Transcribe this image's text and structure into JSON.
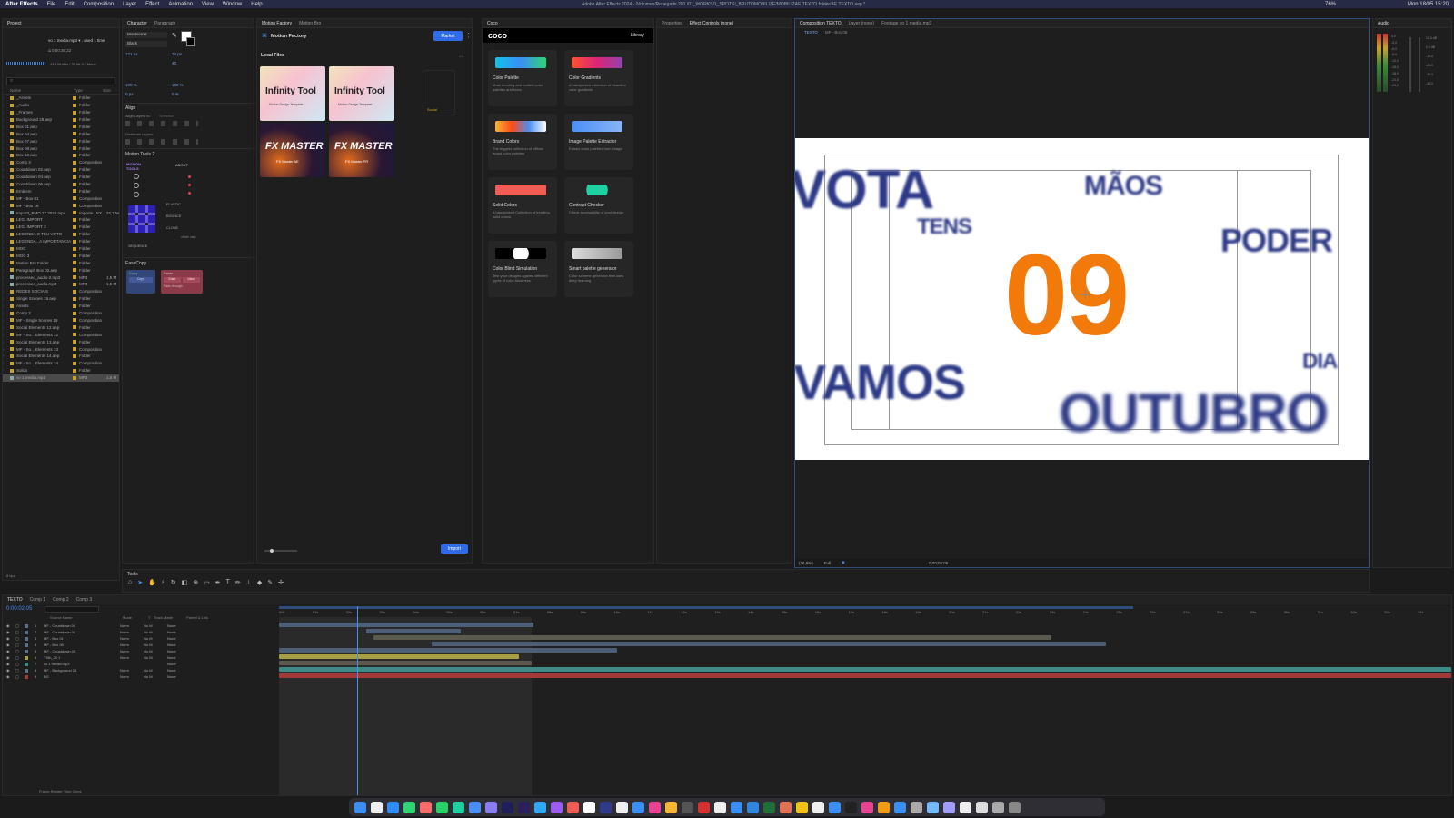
{
  "menubar": {
    "app": "After Effects",
    "items": [
      "File",
      "Edit",
      "Composition",
      "Layer",
      "Effect",
      "Animation",
      "View",
      "Window",
      "Help"
    ],
    "window_title": "Adobe After Effects 2024 - /Volumes/Renegade 201 /01_WORKS/1_SPOTS/_BRUTOMOBILIZE/MOBILIZAE TEXTO folder/AE TEXTO.aep *",
    "clock": "Mon 18/05 15:20",
    "battery": "76%"
  },
  "project": {
    "tab": "Project",
    "selected_file": "vo 1 media.mp3 ▾ , used 1 time",
    "duration": "Δ 0;00;36;22",
    "audio_info": "44,100 kHz / 32 bit U / Mono",
    "columns": [
      "Name",
      "Type",
      "Size"
    ],
    "items": [
      {
        "name": "_Assets",
        "type": "Folder",
        "color": "#c9a227"
      },
      {
        "name": "_Audio",
        "type": "Folder",
        "color": "#c9a227"
      },
      {
        "name": "_Frames",
        "type": "Folder",
        "color": "#c9a227"
      },
      {
        "name": "Background 28.aep",
        "type": "Folder",
        "color": "#c9a227"
      },
      {
        "name": "Box 01.aep",
        "type": "Folder",
        "color": "#c9a227"
      },
      {
        "name": "Box 04.aep",
        "type": "Folder",
        "color": "#c9a227"
      },
      {
        "name": "Box 07.aep",
        "type": "Folder",
        "color": "#c9a227"
      },
      {
        "name": "Box 08.aep",
        "type": "Folder",
        "color": "#c9a227"
      },
      {
        "name": "Box 18.aep",
        "type": "Folder",
        "color": "#c9a227"
      },
      {
        "name": "Comp 3",
        "type": "Composition",
        "color": "#c9a227"
      },
      {
        "name": "Countdown 02.aep",
        "type": "Folder",
        "color": "#c9a227"
      },
      {
        "name": "Countdown 04.aep",
        "type": "Folder",
        "color": "#c9a227"
      },
      {
        "name": "Countdown 06.aep",
        "type": "Folder",
        "color": "#c9a227"
      },
      {
        "name": "Emblem",
        "type": "Folder",
        "color": "#c9a227"
      },
      {
        "name": "MF - Box 01",
        "type": "Composition",
        "color": "#c9a227"
      },
      {
        "name": "MF - Box 18",
        "type": "Composition",
        "color": "#c9a227"
      },
      {
        "name": "Importt_BMO 27 2024.mp4",
        "type": "Importe...EX",
        "size": "32,1 M",
        "color": "#8aa"
      },
      {
        "name": "LEG. IMPORT",
        "type": "Folder",
        "color": "#c9a227"
      },
      {
        "name": "LEG. IMPORT 3",
        "type": "Folder",
        "color": "#c9a227"
      },
      {
        "name": "LEGENDA O TEU VOTO",
        "type": "Folder",
        "color": "#c9a227"
      },
      {
        "name": "LEGENDA...A IMPORTANCIA",
        "type": "Folder",
        "color": "#c9a227"
      },
      {
        "name": "MOC",
        "type": "Folder",
        "color": "#c9a227"
      },
      {
        "name": "MOC 3",
        "type": "Folder",
        "color": "#c9a227"
      },
      {
        "name": "Motion Bro Folder",
        "type": "Folder",
        "color": "#c9a227"
      },
      {
        "name": "Paragraph Box 02.aep",
        "type": "Folder",
        "color": "#c9a227"
      },
      {
        "name": "processed_audio-2.mp3",
        "type": "MP3",
        "size": "1,5 M",
        "color": "#8aa"
      },
      {
        "name": "processed_audio.mp3",
        "type": "MP3",
        "size": "1,5 M",
        "color": "#8aa"
      },
      {
        "name": "REDES SOCIAIS",
        "type": "Composition",
        "color": "#c9a227"
      },
      {
        "name": "Single Scenes 19.aep",
        "type": "Folder",
        "color": "#c9a227"
      },
      {
        "name": "Assets",
        "type": "Folder",
        "color": "#c9a227"
      },
      {
        "name": "Comp 2",
        "type": "Composition",
        "color": "#c9a227"
      },
      {
        "name": "MF - Single Scenes 19",
        "type": "Composition",
        "color": "#c9a227"
      },
      {
        "name": "Social Elements 12.aep",
        "type": "Folder",
        "color": "#c9a227"
      },
      {
        "name": "MF - So... Elements 12",
        "type": "Composition",
        "color": "#c9a227"
      },
      {
        "name": "Social Elements 13.aep",
        "type": "Folder",
        "color": "#c9a227"
      },
      {
        "name": "MF - So... Elements 13",
        "type": "Composition",
        "color": "#c9a227"
      },
      {
        "name": "Social Elements 14.aep",
        "type": "Folder",
        "color": "#c9a227"
      },
      {
        "name": "MF - So... Elements 14",
        "type": "Composition",
        "color": "#c9a227"
      },
      {
        "name": "Solids",
        "type": "Folder",
        "color": "#c9a227"
      },
      {
        "name": "vo 1 media.mp3",
        "type": "MP3",
        "size": "1,5 M",
        "color": "#8aa"
      }
    ],
    "bpc": "8 bpc"
  },
  "character": {
    "tabs": [
      "Character",
      "Paragraph"
    ],
    "font": "Montserrat",
    "style": "Black",
    "size": "121 px",
    "leading": "74 px",
    "tracking": "40",
    "scale_v": "100 %",
    "scale_h": "100 %",
    "baseline": "0 px",
    "tsume": "0 %"
  },
  "align": {
    "title": "Align",
    "align_to": "Align Layers to:",
    "align_target": "Selection",
    "distribute": "Distribute Layers:"
  },
  "motion_tools": {
    "title": "Motion Tools 2",
    "about": "ABOUT",
    "labels": [
      "ELASTIC",
      "BOUNCE",
      "CLONE",
      "SEQUENCE"
    ],
    "sub": [
      "offset",
      "step"
    ]
  },
  "easecopy": {
    "title": "EaseCopy",
    "copy": "Copy",
    "paste": "Paste",
    "ease": "Ease",
    "value": "Value",
    "pass_through": "Pass through"
  },
  "motion_factory": {
    "tabs": [
      "Motion Factory",
      "Motion Bro"
    ],
    "title": "Motion Factory",
    "market": "Market",
    "local_files": "Local Files",
    "thumbs": [
      {
        "title": "Infinity Tool",
        "sub": "Motion Design Template"
      },
      {
        "title": "Infinity Tool",
        "sub": "Motion Design Template"
      },
      {
        "title": "FX MASTER",
        "sub": "FX Master AE"
      },
      {
        "title": "FX MASTER",
        "sub": "FX Master PR"
      }
    ],
    "side_label": "Social",
    "import": "Import"
  },
  "coco": {
    "tab": "Coco",
    "logo": "coco",
    "library": "Library",
    "cards": [
      {
        "title": "Color Palette",
        "desc": "Most trending and crafted color palettes and hues"
      },
      {
        "title": "Color Gradients",
        "desc": "A handpicked collection of beautiful color gradients"
      },
      {
        "title": "Brand Colors",
        "desc": "The biggest collection of official brand color palettes"
      },
      {
        "title": "Image Palette Extractor",
        "desc": "Extract color palettes from image"
      },
      {
        "title": "Solid Colors",
        "desc": "A handpicked Collection of trending solid colors"
      },
      {
        "title": "Contrast Checker",
        "desc": "Check accessibility of your design"
      },
      {
        "title": "Color Blind Simulation",
        "desc": "Test your designs against different types of color blindness"
      },
      {
        "title": "Smart palette generator",
        "desc": "Color scheme generator that uses deep learning"
      }
    ]
  },
  "middle_tabs": {
    "properties": "Properties",
    "effect_controls": "Effect Controls (none)"
  },
  "composition": {
    "tabs": [
      "Composition TEXTO",
      "Layer (none)",
      "Footage vo 1 media.mp3"
    ],
    "subtabs": [
      "TEXTO",
      "MF - Box 08"
    ],
    "words": [
      "VOTA",
      "MÃOS",
      "TENS",
      "PODER",
      "09",
      "VAMOS",
      "DIA",
      "OUTUBRO"
    ],
    "zoom": "(76,8%)",
    "quality": "Full",
    "timecode": "0;00;02;05",
    "accent": "#f27a0b",
    "word_color": "#2e3a86"
  },
  "audio": {
    "tab": "Audio",
    "levels": [
      "0,0",
      "-3,0",
      "-6,0",
      "-9,0",
      "-12,0",
      "-15,0",
      "-18,0",
      "-21,0",
      "-24,0"
    ],
    "db": [
      "12,0 dB",
      "0,0 dB",
      "-12,0",
      "-24,0",
      "-36,0",
      "-48,0"
    ]
  },
  "tools": {
    "title": "Tools"
  },
  "timeline": {
    "tabs": [
      "TEXTO",
      "Comp 1",
      "Comp 2",
      "Comp 3"
    ],
    "timecode": "0:00:02:05",
    "columns": [
      "Source Name",
      "Mode",
      "T",
      "Track Matte",
      "Parent & Link"
    ],
    "layers": [
      {
        "n": "1",
        "name": "MF - Countdown 04",
        "mode": "Norm",
        "matte": "No M",
        "parent": "None",
        "color": "#5a6f8a"
      },
      {
        "n": "2",
        "name": "MF - Countdown 04",
        "mode": "Norm",
        "matte": "No M",
        "parent": "None",
        "color": "#5a6f8a"
      },
      {
        "n": "3",
        "name": "MF - Box 01",
        "mode": "Norm",
        "matte": "No M",
        "parent": "None",
        "color": "#5a6f8a"
      },
      {
        "n": "4",
        "name": "MF - Box 08",
        "mode": "Norm",
        "matte": "No M",
        "parent": "None",
        "color": "#5a6f8a"
      },
      {
        "n": "5",
        "name": "MF - Countdown 02",
        "mode": "Norm",
        "matte": "No M",
        "parent": "None",
        "color": "#5a6f8a"
      },
      {
        "n": "6",
        "name": "TXth_20 1",
        "mode": "Norm",
        "matte": "No M",
        "parent": "None",
        "color": "#a89f45"
      },
      {
        "n": "7",
        "name": "vo 1 media.mp3",
        "mode": "",
        "matte": "",
        "parent": "None",
        "color": "#3e8a86"
      },
      {
        "n": "8",
        "name": "MF - Background 28",
        "mode": "Norm",
        "matte": "No M",
        "parent": "None",
        "color": "#5a6f8a"
      },
      {
        "n": "9",
        "name": "BG",
        "mode": "Norm",
        "matte": "No M",
        "parent": "None",
        "color": "#a23a3a"
      }
    ],
    "ruler": [
      "00f",
      "01s",
      "02s",
      "03s",
      "04s",
      "05s",
      "06s",
      "07s",
      "08s",
      "09s",
      "10s",
      "11s",
      "12s",
      "13s",
      "14s",
      "15s",
      "16s",
      "17s",
      "18s",
      "19s",
      "20s",
      "21s",
      "22s",
      "23s",
      "24s",
      "25s",
      "26s",
      "27s",
      "28s",
      "29s",
      "30s",
      "31s",
      "32s",
      "33s",
      "34s"
    ],
    "render_time": "Frame Render Time 41ms"
  }
}
